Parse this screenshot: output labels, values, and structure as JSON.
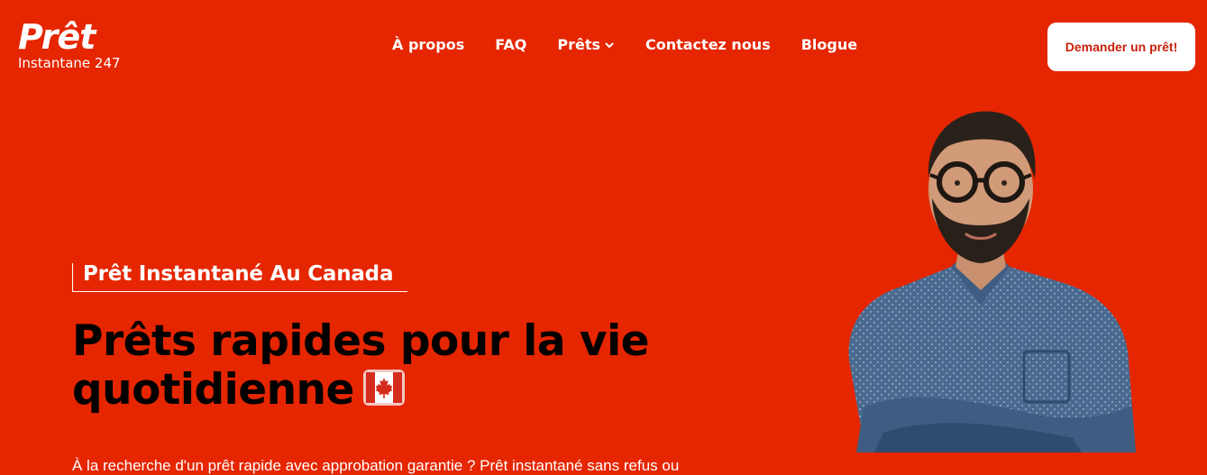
{
  "logo": {
    "main": "Prêt",
    "sub": "Instantane 247"
  },
  "nav": {
    "items": [
      {
        "label": "À propos"
      },
      {
        "label": "FAQ"
      },
      {
        "label": "Prêts",
        "has_dropdown": true
      },
      {
        "label": "Contactez nous"
      },
      {
        "label": "Blogue"
      }
    ]
  },
  "cta": {
    "label": "Demander un prêt!"
  },
  "hero": {
    "eyebrow": "Prêt Instantané Au Canada",
    "headline_line1": "Prêts rapides pour la vie",
    "headline_line2": "quotidienne",
    "paragraph": "À la recherche d'un prêt rapide avec approbation garantie ? Prêt instantané sans refus ou"
  },
  "icons": {
    "flag": "canada-flag-icon",
    "chevron": "chevron-down-icon"
  },
  "colors": {
    "background": "#e52600",
    "cta_text": "#c8210b",
    "headline": "#000000",
    "text": "#ffffff"
  }
}
